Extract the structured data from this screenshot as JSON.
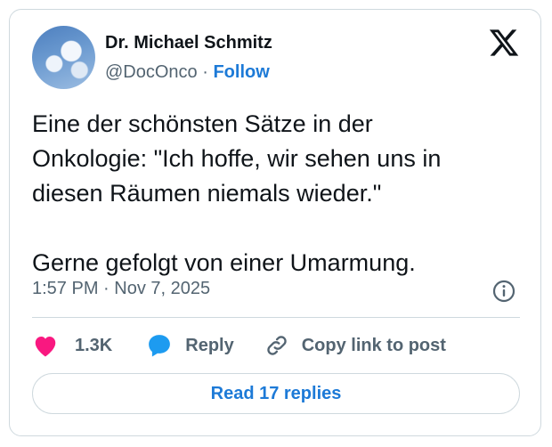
{
  "author": {
    "name": "Dr. Michael Schmitz",
    "handle": "@DocOnco",
    "separator": "·",
    "follow_label": "Follow",
    "avatar_icon": "avatar-clouds"
  },
  "tweet": {
    "text": "Eine der schönsten Sätze in der\nOnkologie: \"Ich hoffe, wir sehen uns in\ndiesen Räumen niemals wieder.\"\n\nGerne gefolgt von einer Umarmung.",
    "timestamp": "1:57 PM · Nov 7, 2025"
  },
  "actions": {
    "like_count": "1.3K",
    "reply_label": "Reply",
    "copy_label": "Copy link to post"
  },
  "read_replies_label": "Read 17 replies",
  "colors": {
    "accent": "#1d7ad7",
    "like": "#f91880",
    "reply_icon": "#1d9bf0",
    "muted": "#536471"
  }
}
